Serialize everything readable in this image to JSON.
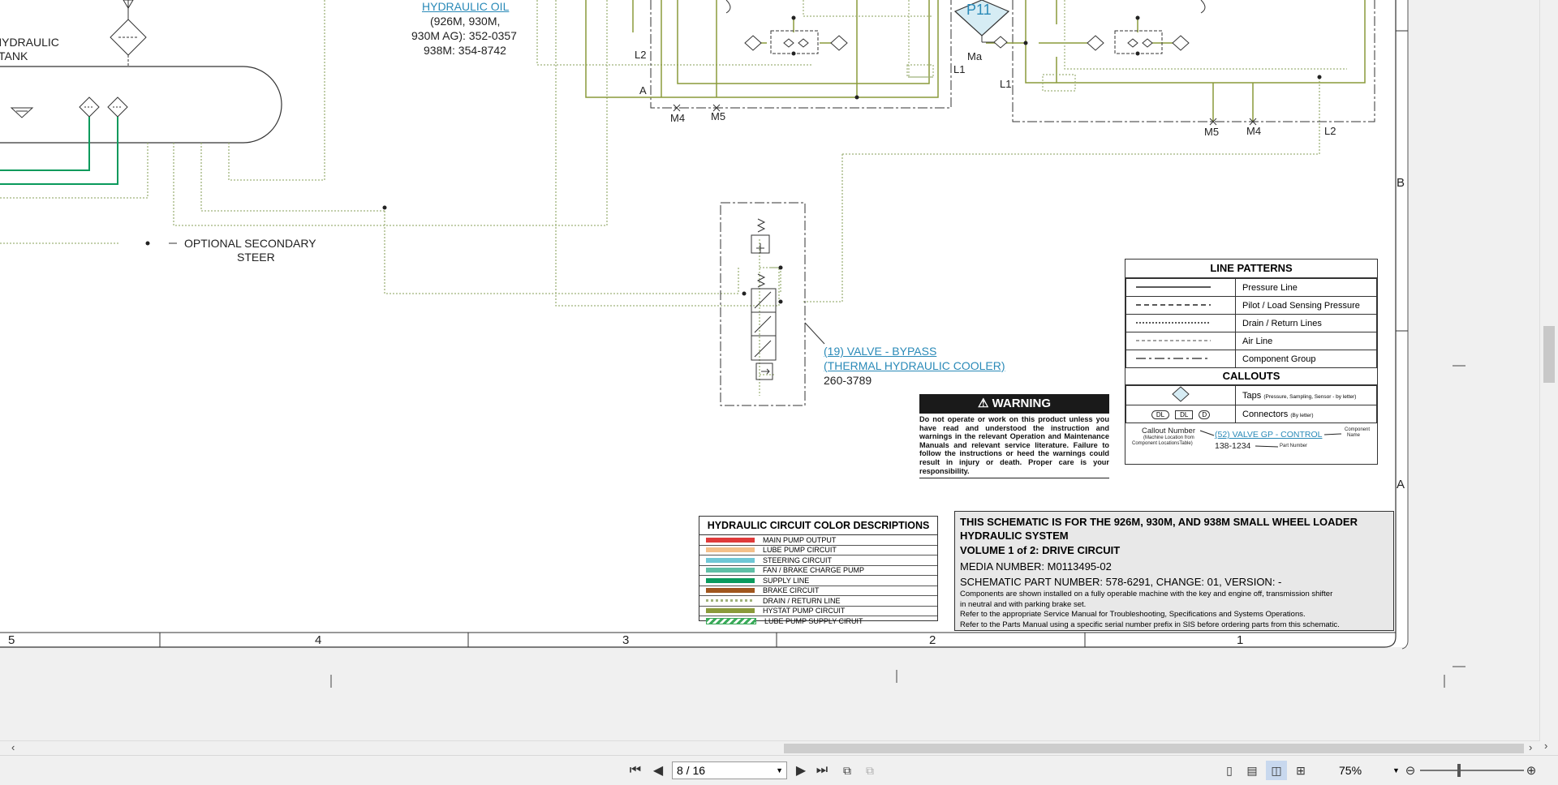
{
  "labels": {
    "hydraulic_tank": [
      "HYDRAULIC",
      "TANK"
    ],
    "optional_secondary_steer": [
      "OPTIONAL SECONDARY",
      "STEER"
    ],
    "hydraulic_oil_link": "HYDRAULIC OIL",
    "hydraulic_oil_lines": [
      "(926M, 930M,",
      "930M AG): 352-0357",
      "938M: 354-8742"
    ],
    "p11": "P11",
    "ports": {
      "l2_left": "L2",
      "a": "A",
      "m4_left": "M4",
      "m5_left": "M5",
      "l1_left": "L1",
      "ma": "Ma",
      "l1_right": "L1",
      "m5_right": "M5",
      "m4_right": "M4",
      "l2_right": "L2"
    },
    "bypass_valve_link": [
      "(19) VALVE - BYPASS",
      "(THERMAL HYDRAULIC COOLER)"
    ],
    "bypass_valve_part": "260-3789",
    "zone_letters": [
      "B",
      "A"
    ],
    "grid_numbers": [
      "5",
      "4",
      "3",
      "2",
      "1"
    ]
  },
  "line_patterns": {
    "title": "LINE PATTERNS",
    "rows": [
      "Pressure Line",
      "Pilot / Load Sensing Pressure",
      "Drain / Return Lines",
      "Air Line",
      "Component Group"
    ],
    "callouts_title": "CALLOUTS",
    "taps_label": "Taps",
    "taps_note": "(Pressure, Sampling, Sensor - by letter)",
    "taps_symbol": "XX",
    "connectors_label": "Connectors",
    "connectors_note": "(By letter)",
    "connector_symbols": [
      "DL",
      "DL",
      "D"
    ],
    "callout_number": "Callout Number",
    "callout_number_note": [
      "(Machine Location from",
      "Component LocationsTable)"
    ],
    "callout_example_link": "(52) VALVE GP - CONTROL",
    "callout_example_part": "138-1234",
    "component_name": [
      "Component",
      "Name"
    ],
    "part_number": "Part Number"
  },
  "warning": {
    "title": "WARNING",
    "text": "Do not operate or work on this product unless you have read and understood the instruction and warnings in the relevant Operation and Maintenance Manuals and relevant service literature. Failure to follow the instructions or heed the warnings could result in injury or death. Proper care is your responsibility."
  },
  "color_descriptions": {
    "title": "HYDRAULIC CIRCUIT COLOR DESCRIPTIONS",
    "rows": [
      {
        "label": "MAIN PUMP OUTPUT",
        "color": "#e03a3a"
      },
      {
        "label": "LUBE PUMP CIRCUIT",
        "color": "#f4c08a"
      },
      {
        "label": "STEERING CIRCUIT",
        "color": "#6fc7d6"
      },
      {
        "label": "FAN / BRAKE CHARGE PUMP",
        "color": "#5fbfa6"
      },
      {
        "label": "SUPPLY LINE",
        "color": "#0a9a5c"
      },
      {
        "label": "BRAKE CIRCUIT",
        "color": "#a0561e"
      },
      {
        "label": "DRAIN / RETURN LINE",
        "color": "#9fb27a"
      },
      {
        "label": "HYSTAT PUMP CIRCUIT",
        "color": "#8a9a3a"
      },
      {
        "label": "LUBE PUMP SUPPLY CIRUIT",
        "color": "#3aaa5a"
      }
    ]
  },
  "title_block": {
    "line1": "THIS SCHEMATIC IS FOR THE 926M, 930M, AND 938M SMALL WHEEL LOADER",
    "line2": "HYDRAULIC SYSTEM",
    "volume": "VOLUME 1 of 2: DRIVE CIRCUIT",
    "media": "MEDIA NUMBER: M0113495-02",
    "part": "SCHEMATIC PART NUMBER: 578-6291, CHANGE: 01, VERSION: -",
    "notes": [
      "Components are shown installed on a fully operable machine with the key and engine off, transmission shifter",
      "in neutral and with parking brake set.",
      "Refer to the appropriate Service Manual for Troubleshooting, Specifications and Systems Operations.",
      "Refer to the Parts Manual using a specific serial number prefix in SIS before ordering parts from this schematic."
    ]
  },
  "toolbar": {
    "page_value": "8 / 16",
    "zoom": "75%"
  },
  "colors": {
    "drain": "#9fb27a",
    "hystat": "#8a9a3a",
    "supply": "#0a9a5c",
    "link": "#2a8ab8"
  }
}
